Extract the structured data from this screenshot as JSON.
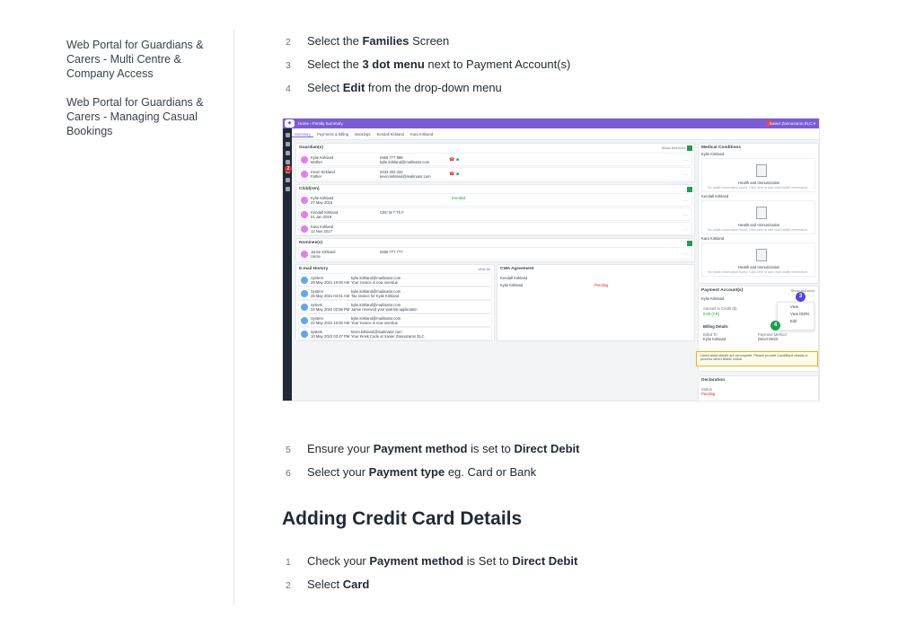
{
  "sidebar": {
    "links": [
      "Web Portal for Guardians & Carers - Multi Centre & Company Access",
      "Web Portal for Guardians & Carers - Managing Casual Bookings"
    ]
  },
  "steps_top": [
    {
      "num": "2",
      "pre": "Select the ",
      "bold": "Families",
      "post": " Screen"
    },
    {
      "num": "3",
      "pre": "Select the ",
      "bold": "3 dot menu",
      "post": " next to Payment Account(s)"
    },
    {
      "num": "4",
      "pre": "Select ",
      "bold": "Edit",
      "post": " from the drop-down menu"
    }
  ],
  "steps_mid": [
    {
      "num": "5",
      "pre": "Ensure your ",
      "bold": "Payment method",
      "mid": " is set to ",
      "bold2": "Direct Debit"
    },
    {
      "num": "6",
      "pre": "Select your ",
      "bold": "Payment type",
      "mid": " eg. Card or Bank",
      "bold2": ""
    }
  ],
  "heading": "Adding Credit Card Details",
  "steps_bottom": [
    {
      "num": "1",
      "pre": "Check your ",
      "bold": "Payment method",
      "mid": " is Set to ",
      "bold2": "Direct Debit"
    },
    {
      "num": "2",
      "pre": "Select ",
      "bold": "Card",
      "mid": "",
      "bold2": ""
    }
  ],
  "screenshot": {
    "breadcrumb": "Home › Family Summary",
    "user": "Xavier Zannazaron ELC ▾",
    "tabs": [
      "Summary",
      "Payments & Billing",
      "Bookings",
      "Kendall Kirkland",
      "Kara Kirkland"
    ],
    "guardians_title": "Guardian(s)",
    "guardians": [
      {
        "name": "Kylie Kirkland",
        "role": "Mother",
        "phone": "0455 777 888",
        "email": "kylie.kirkland@mailinator.com"
      },
      {
        "name": "Kevin Kirkland",
        "role": "Father",
        "phone": "0433 333 333",
        "email": "kevin.kirkland@mailinator.com"
      }
    ],
    "children_title": "Child(ren)",
    "children": [
      {
        "name": "Kylie Kirkland",
        "dob": "27 May 2015",
        "extra": "Enrolled"
      },
      {
        "name": "Kendall Kirkland",
        "dob": "01 Jan 2019",
        "extra": "CBC    M T Th F"
      },
      {
        "name": "Kara Kirkland",
        "dob": "12 Nov 2017",
        "extra": ""
      }
    ],
    "nominees_title": "Nominee(s)",
    "nominees": [
      {
        "name": "Jamie Kirkland",
        "role": "Uncle",
        "phone": "0455 777 777"
      }
    ],
    "email_title": "E-mail History",
    "email_view_all": "View All",
    "emails": [
      {
        "from": "System",
        "date": "29 May 2021 10:00 AM",
        "to": "kylie.kirkland@mailinator.com",
        "subject": "Your invoice is now overdue"
      },
      {
        "from": "System",
        "date": "25 May 2021 04:01 AM",
        "to": "kylie.kirkland@mailinator.com",
        "subject": "Tax invoice for Kylie Kirkland"
      },
      {
        "from": "system",
        "date": "24 May 2022 02:58 PM",
        "to": "kylie.kirkland@mailinator.com",
        "subject": "Jamie received your wait list application"
      },
      {
        "from": "System",
        "date": "22 May 2022 10:00 AM",
        "to": "kylie.kirkland@mailinator.com",
        "subject": "Your invoice is now overdue"
      },
      {
        "from": "system",
        "date": "10 May 2022 03:47 PM",
        "to": "kevin.kirkland@mailinator.com",
        "subject": "Your Kiosk Code at Xavier Zannazaron ELC"
      }
    ],
    "cwa_title": "CWA Agreement",
    "cwa_name": "Kendall Kirkland",
    "cwa_carer": "Kylie Kirkland",
    "cwa_status": "Pending",
    "medical_title": "Medical Conditions",
    "medical": [
      "Kylie Kirkland",
      "Kendall Kirkland",
      "Kara Kirkland"
    ],
    "medical_box_title": "Health and Immunization",
    "medical_box_sub": "No health information found. Click here to add child health information.",
    "payment_title": "Payment Account(s)",
    "payment_show_archived": "Show Archived",
    "payment_name": "Kylie Kirkland",
    "payment_credit_label": "Amount in Credit ($)",
    "payment_credit": "0.00 (CR)",
    "billing_title": "Billing Details",
    "billed_to_label": "Billed To",
    "billed_to": "Kylie Kirkland",
    "pay_method_label": "Payment Method",
    "pay_method": "Direct Debit",
    "warning": "Direct debit details are incomplete. Please provide Card/Bank details to process direct debits online.",
    "dropdown": [
      "View",
      "View DDRs",
      "Edit"
    ],
    "declaration_title": "Declaration",
    "declaration_status_label": "Status",
    "declaration_status": "Pending",
    "callouts": [
      "2",
      "3",
      "4"
    ]
  },
  "colors": {
    "purple": "#7c5cd6",
    "green": "#16a34a",
    "red": "#dc2626",
    "blue": "#4f46e5"
  }
}
